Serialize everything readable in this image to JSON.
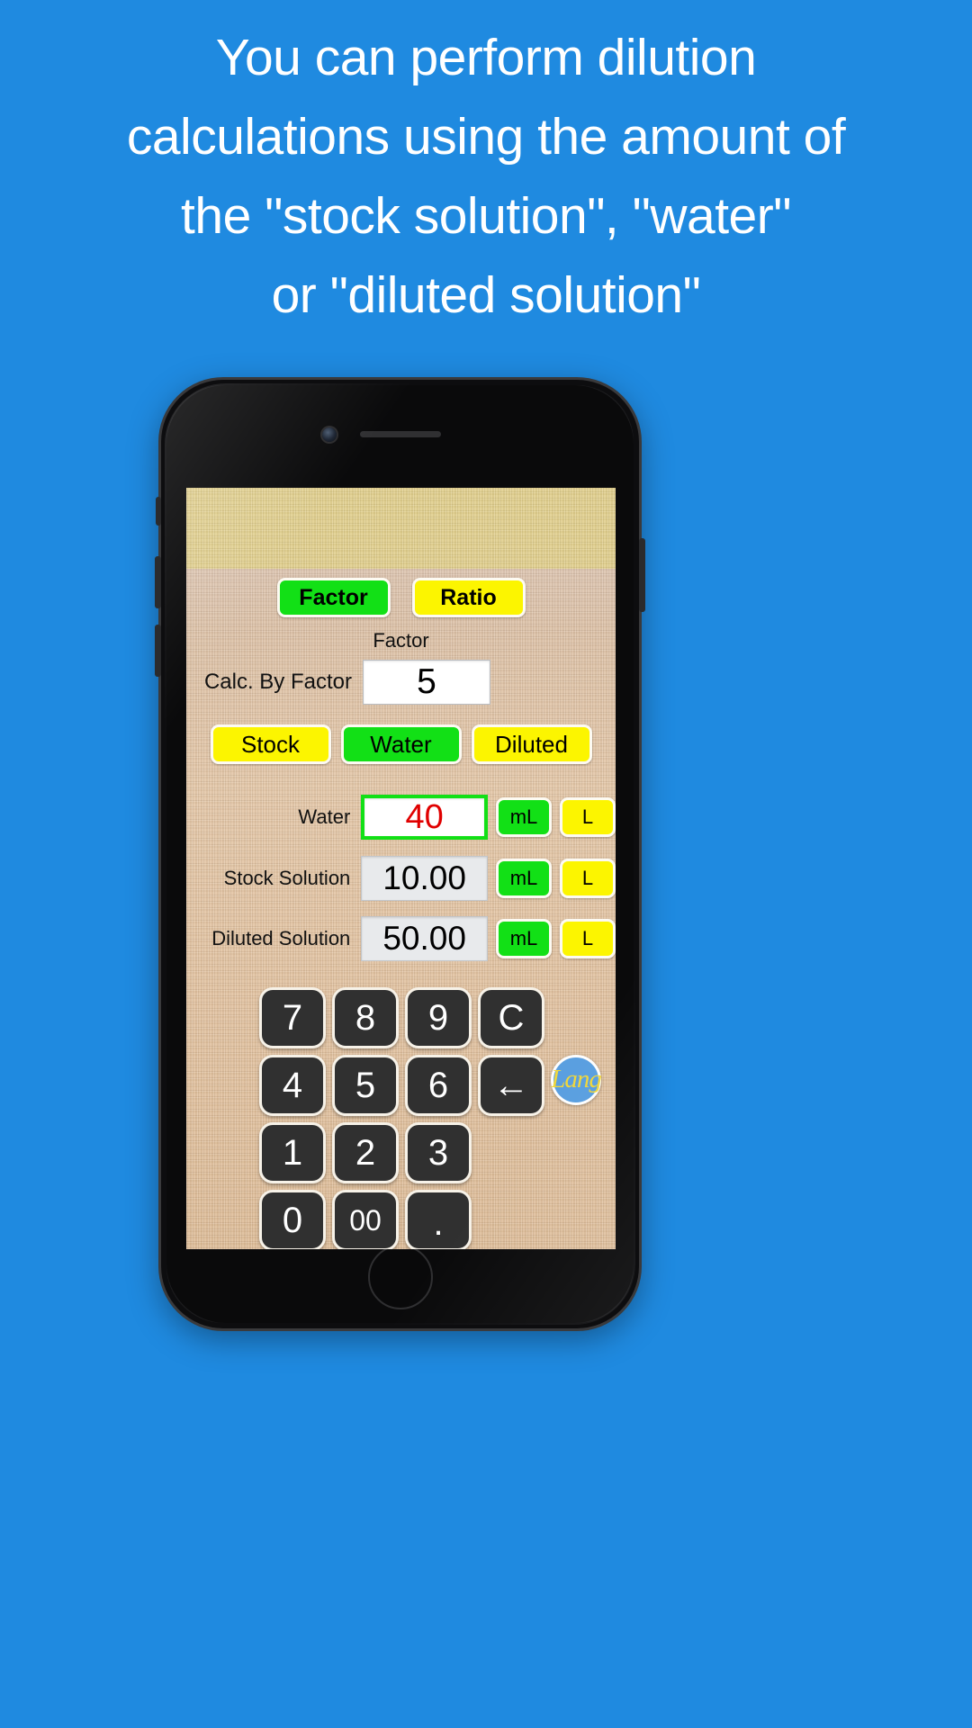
{
  "page": {
    "background_color": "#1f8ae0"
  },
  "headline": {
    "lines": [
      "You can perform dilution",
      "calculations using the amount of",
      "the \"stock solution\", \"water\"",
      "or \"diluted solution\""
    ],
    "color": "#ffffff"
  },
  "app": {
    "colors": {
      "selected_green": "#12e016",
      "unselected_yellow": "#fcf500",
      "active_value_text": "#e00000",
      "screen_band_top": "#e0ce8b",
      "screen_background": "#e1c4a4",
      "key_background": "#303030"
    },
    "mode_buttons": [
      {
        "label": "Factor",
        "state": "selected"
      },
      {
        "label": "Ratio",
        "state": "unselected"
      }
    ],
    "mode_caption": "Factor",
    "factor_row": {
      "label": "Calc. By Factor",
      "value": "5"
    },
    "target_buttons": [
      {
        "label": "Stock",
        "state": "unselected"
      },
      {
        "label": "Water",
        "state": "selected"
      },
      {
        "label": "Diluted",
        "state": "unselected"
      }
    ],
    "value_rows": [
      {
        "label": "Water",
        "value": "40",
        "editable": true,
        "units": [
          {
            "label": "mL",
            "state": "selected"
          },
          {
            "label": "L",
            "state": "unselected"
          }
        ]
      },
      {
        "label": "Stock Solution",
        "value": "10.00",
        "editable": false,
        "units": [
          {
            "label": "mL",
            "state": "selected"
          },
          {
            "label": "L",
            "state": "unselected"
          }
        ]
      },
      {
        "label": "Diluted Solution",
        "value": "50.00",
        "editable": false,
        "units": [
          {
            "label": "mL",
            "state": "selected"
          },
          {
            "label": "L",
            "state": "unselected"
          }
        ]
      }
    ],
    "keypad": [
      {
        "label": "7",
        "kind": "digit"
      },
      {
        "label": "8",
        "kind": "digit"
      },
      {
        "label": "9",
        "kind": "digit"
      },
      {
        "label": "C",
        "kind": "clear"
      },
      {
        "label": "4",
        "kind": "digit"
      },
      {
        "label": "5",
        "kind": "digit"
      },
      {
        "label": "6",
        "kind": "digit"
      },
      {
        "label": "←",
        "kind": "backspace"
      },
      {
        "label": "1",
        "kind": "digit"
      },
      {
        "label": "2",
        "kind": "digit"
      },
      {
        "label": "3",
        "kind": "digit"
      },
      {
        "label": "",
        "kind": "blank"
      },
      {
        "label": "0",
        "kind": "digit"
      },
      {
        "label": "00",
        "kind": "digit-double"
      },
      {
        "label": ".",
        "kind": "decimal"
      },
      {
        "label": "",
        "kind": "blank"
      }
    ],
    "brand_logo": {
      "text": "Lang",
      "circle_color": "#5a9fe0",
      "text_color": "#f0d73c"
    }
  }
}
